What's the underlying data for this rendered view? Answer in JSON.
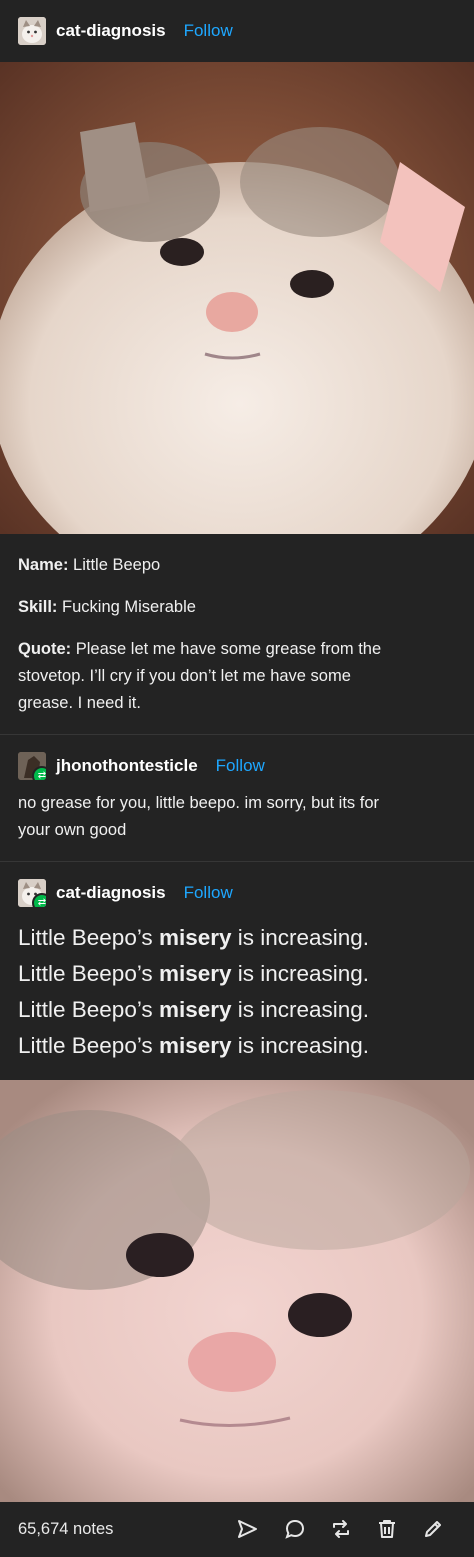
{
  "post": {
    "author": "cat-diagnosis",
    "follow_label": "Follow",
    "caption": {
      "name_label": "Name:",
      "name_value": " Little Beepo",
      "skill_label": "Skill:",
      "skill_value": " Fucking Miserable",
      "quote_label": "Quote:",
      "quote_line1": " Please let me have some grease from the",
      "quote_line2": "stovetop. I’ll cry if you don’t let me have some",
      "quote_line3": "grease. I need it."
    }
  },
  "reblogs": [
    {
      "author": "jhonothontesticle",
      "follow_label": "Follow",
      "line1": "no grease for you, little beepo. im sorry, but its for",
      "line2": "your own good"
    },
    {
      "author": "cat-diagnosis",
      "follow_label": "Follow",
      "phrase_before": "Little Beepo’s ",
      "phrase_bold": "misery",
      "phrase_after": " is increasing."
    }
  ],
  "footer": {
    "notes": "65,674 notes",
    "actions": [
      "share-icon",
      "reply-icon",
      "reblog-icon",
      "delete-icon",
      "edit-icon"
    ]
  },
  "colors": {
    "accent": "#1ea7ff",
    "reblog_badge": "#00b94a",
    "background": "#232323"
  }
}
